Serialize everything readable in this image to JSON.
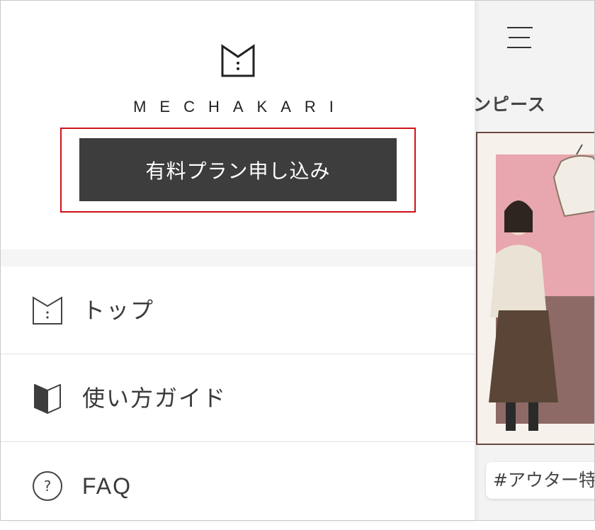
{
  "brand": {
    "name": "MECHAKARI"
  },
  "plan_button": {
    "label": "有料プラン申し込み"
  },
  "menu": [
    {
      "label": "トップ",
      "icon": "mechakari-logo-icon"
    },
    {
      "label": "使い方ガイド",
      "icon": "book-icon"
    },
    {
      "label": "FAQ",
      "icon": "question-circle-icon"
    }
  ],
  "background_page": {
    "heading": "ンピース",
    "hashtag": "#アウター特"
  },
  "colors": {
    "button_bg": "#3d3d3d",
    "highlight_border": "#d0121b",
    "text": "#3a3a3a"
  }
}
